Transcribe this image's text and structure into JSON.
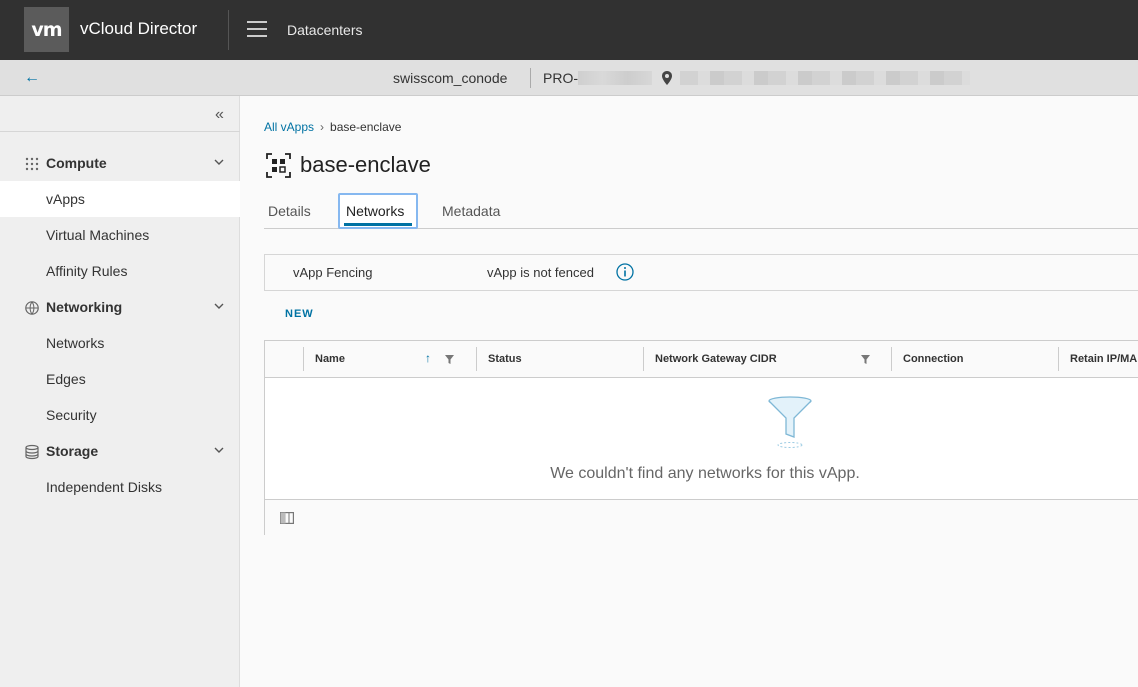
{
  "header": {
    "logo": "vm",
    "app_title": "vCloud Director",
    "nav_label": "Datacenters"
  },
  "context": {
    "org_name": "swisscom_conode",
    "vdc_prefix": "PRO-"
  },
  "sidebar": {
    "groups": [
      {
        "label": "Compute",
        "icon": "compute-grid-icon",
        "items": [
          "vApps",
          "Virtual Machines",
          "Affinity Rules"
        ]
      },
      {
        "label": "Networking",
        "icon": "networking-globe-icon",
        "items": [
          "Networks",
          "Edges",
          "Security"
        ]
      },
      {
        "label": "Storage",
        "icon": "storage-database-icon",
        "items": [
          "Independent Disks"
        ]
      }
    ],
    "active_item": "vApps"
  },
  "breadcrumb": {
    "parent": "All vApps",
    "current": "base-enclave"
  },
  "page": {
    "title": "base-enclave"
  },
  "tabs": [
    {
      "label": "Details",
      "active": false
    },
    {
      "label": "Networks",
      "active": true
    },
    {
      "label": "Metadata",
      "active": false
    }
  ],
  "fencing": {
    "label": "vApp Fencing",
    "value": "vApp is not fenced"
  },
  "actions": {
    "new_label": "NEW"
  },
  "grid": {
    "columns": [
      "Name",
      "Status",
      "Network Gateway CIDR",
      "Connection",
      "Retain IP/MA"
    ],
    "empty_message": "We couldn't find any networks for this vApp."
  },
  "colors": {
    "accent": "#0072a3",
    "topbar": "#313131",
    "focus_ring": "#86b8f0"
  }
}
